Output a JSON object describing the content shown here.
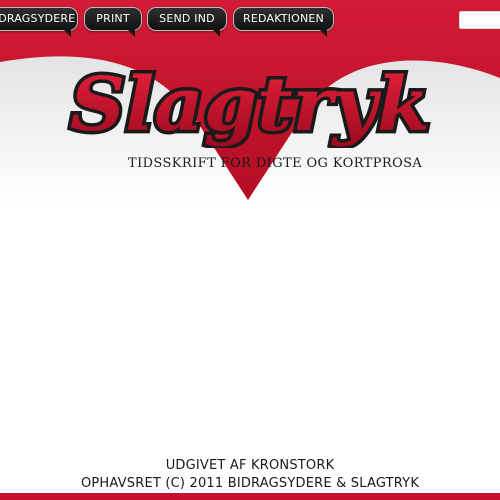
{
  "nav": {
    "items": [
      {
        "label": "BIDRAGSYDERE"
      },
      {
        "label": "PRINT"
      },
      {
        "label": "SEND IND"
      },
      {
        "label": "REDAKTIONEN"
      }
    ]
  },
  "search": {
    "value": ""
  },
  "logo": {
    "text": "Slagtryk",
    "tagline": "TIDSSKRIFT FOR DIGTE OG KORTPROSA"
  },
  "footer": {
    "publisher": "UDGIVET AF KRONSTORK",
    "copyright": "OPHAVSRET (C) 2011 BIDRAGSYDERE & SLAGTRYK"
  },
  "colors": {
    "brand_red": "#c8102e",
    "dark_red": "#8e0b1d",
    "tab_dark": "#1c1c1c"
  }
}
